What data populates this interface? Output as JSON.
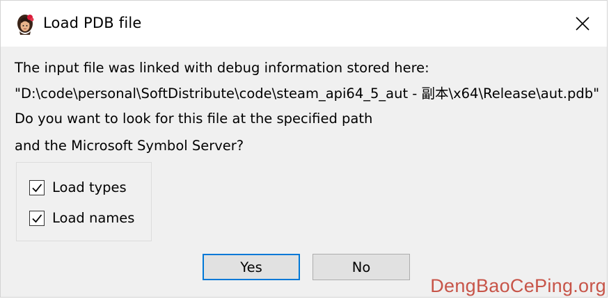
{
  "window": {
    "title": "Load PDB file",
    "app_icon": "ida-icon"
  },
  "message": {
    "line1": "The input file was linked with debug information stored here:",
    "line2": "\"D:\\code\\personal\\SoftDistribute\\code\\steam_api64_5_aut - 副本\\x64\\Release\\aut.pdb\"",
    "line3": "Do you want to look for this file at the specified path",
    "line4": "and the Microsoft Symbol Server?"
  },
  "options": [
    {
      "label": "Load types",
      "checked": true
    },
    {
      "label": "Load names",
      "checked": true
    }
  ],
  "buttons": {
    "yes": "Yes",
    "no": "No"
  },
  "watermark": "DengBaoCePing.org",
  "colors": {
    "accent": "#0078d7",
    "watermark": "#c0392b"
  }
}
